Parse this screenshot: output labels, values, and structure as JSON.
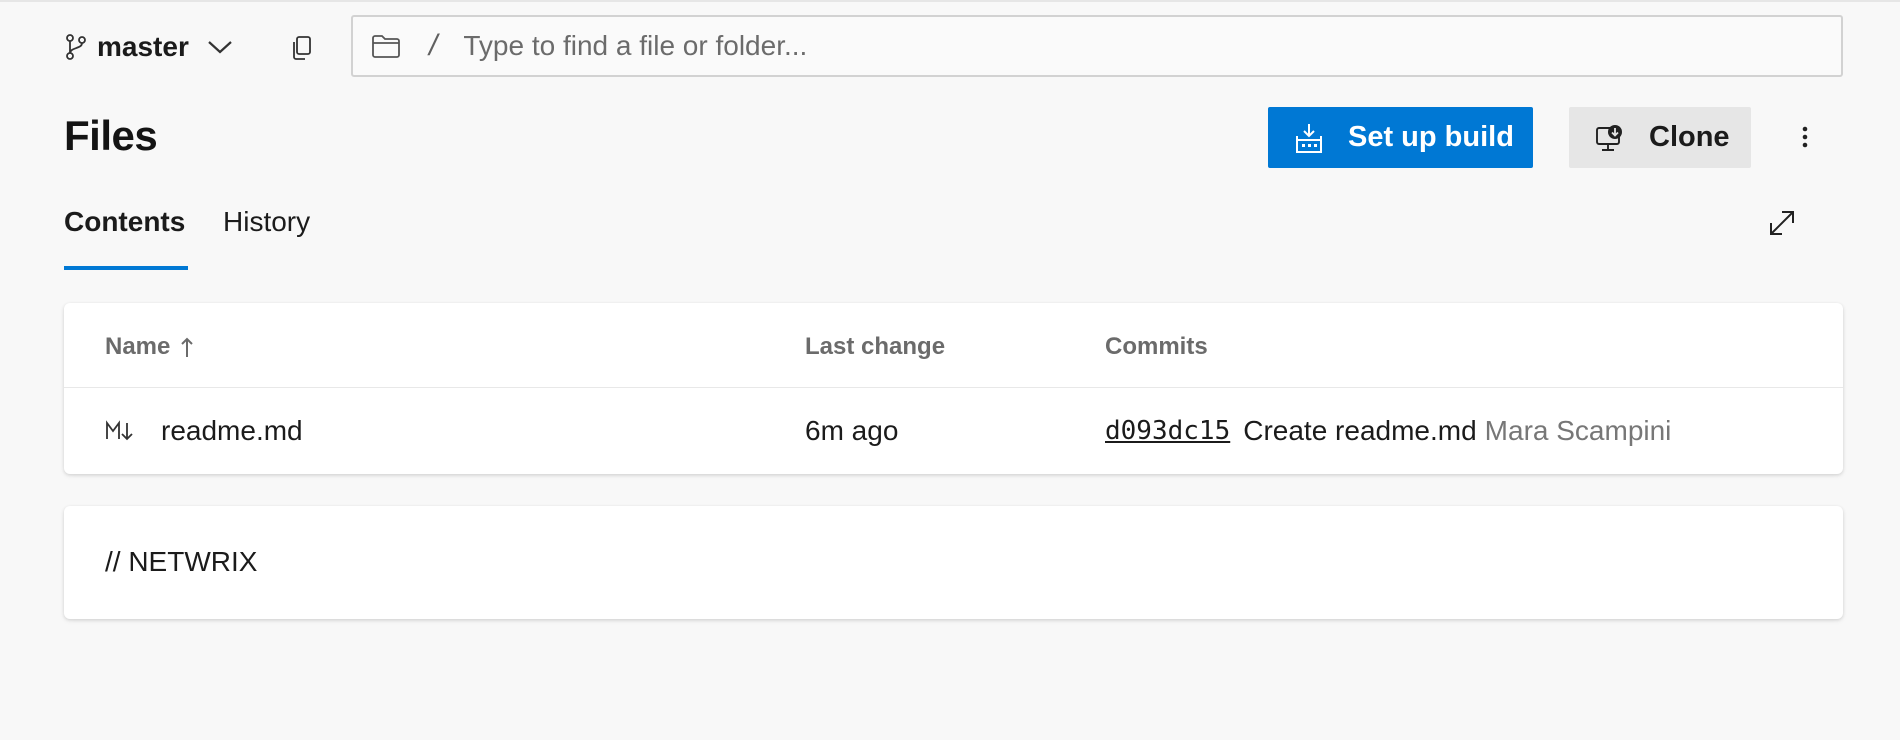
{
  "branch": {
    "name": "master",
    "icon": "branch-icon",
    "dropdown_icon": "chevron-down-icon"
  },
  "toolbar": {
    "copy_icon": "copy-icon"
  },
  "path_bar": {
    "folder_icon": "folder-icon",
    "separator": "/",
    "placeholder": "Type to find a file or folder...",
    "value": ""
  },
  "header": {
    "title": "Files",
    "setup_build_label": "Set up build",
    "setup_build_icon": "build-icon",
    "clone_label": "Clone",
    "clone_icon": "clone-icon",
    "more_icon": "more-vertical-icon"
  },
  "tabs": [
    {
      "label": "Contents",
      "active": true
    },
    {
      "label": "History",
      "active": false
    }
  ],
  "expand_icon": "expand-icon",
  "table": {
    "columns": {
      "name": "Name",
      "sort_icon": "arrow-up-icon",
      "last_change": "Last change",
      "commits": "Commits"
    },
    "rows": [
      {
        "icon": "markdown-icon",
        "name": "readme.md",
        "last_change": "6m ago",
        "commit_id": "d093dc15",
        "commit_message": "Create readme.md",
        "author": "Mara Scampini"
      }
    ]
  },
  "readme": {
    "content": "// NETWRIX"
  },
  "colors": {
    "accent": "#0078d4",
    "background": "#f8f8f8",
    "card": "#ffffff",
    "muted_text": "#6b6b6b"
  }
}
